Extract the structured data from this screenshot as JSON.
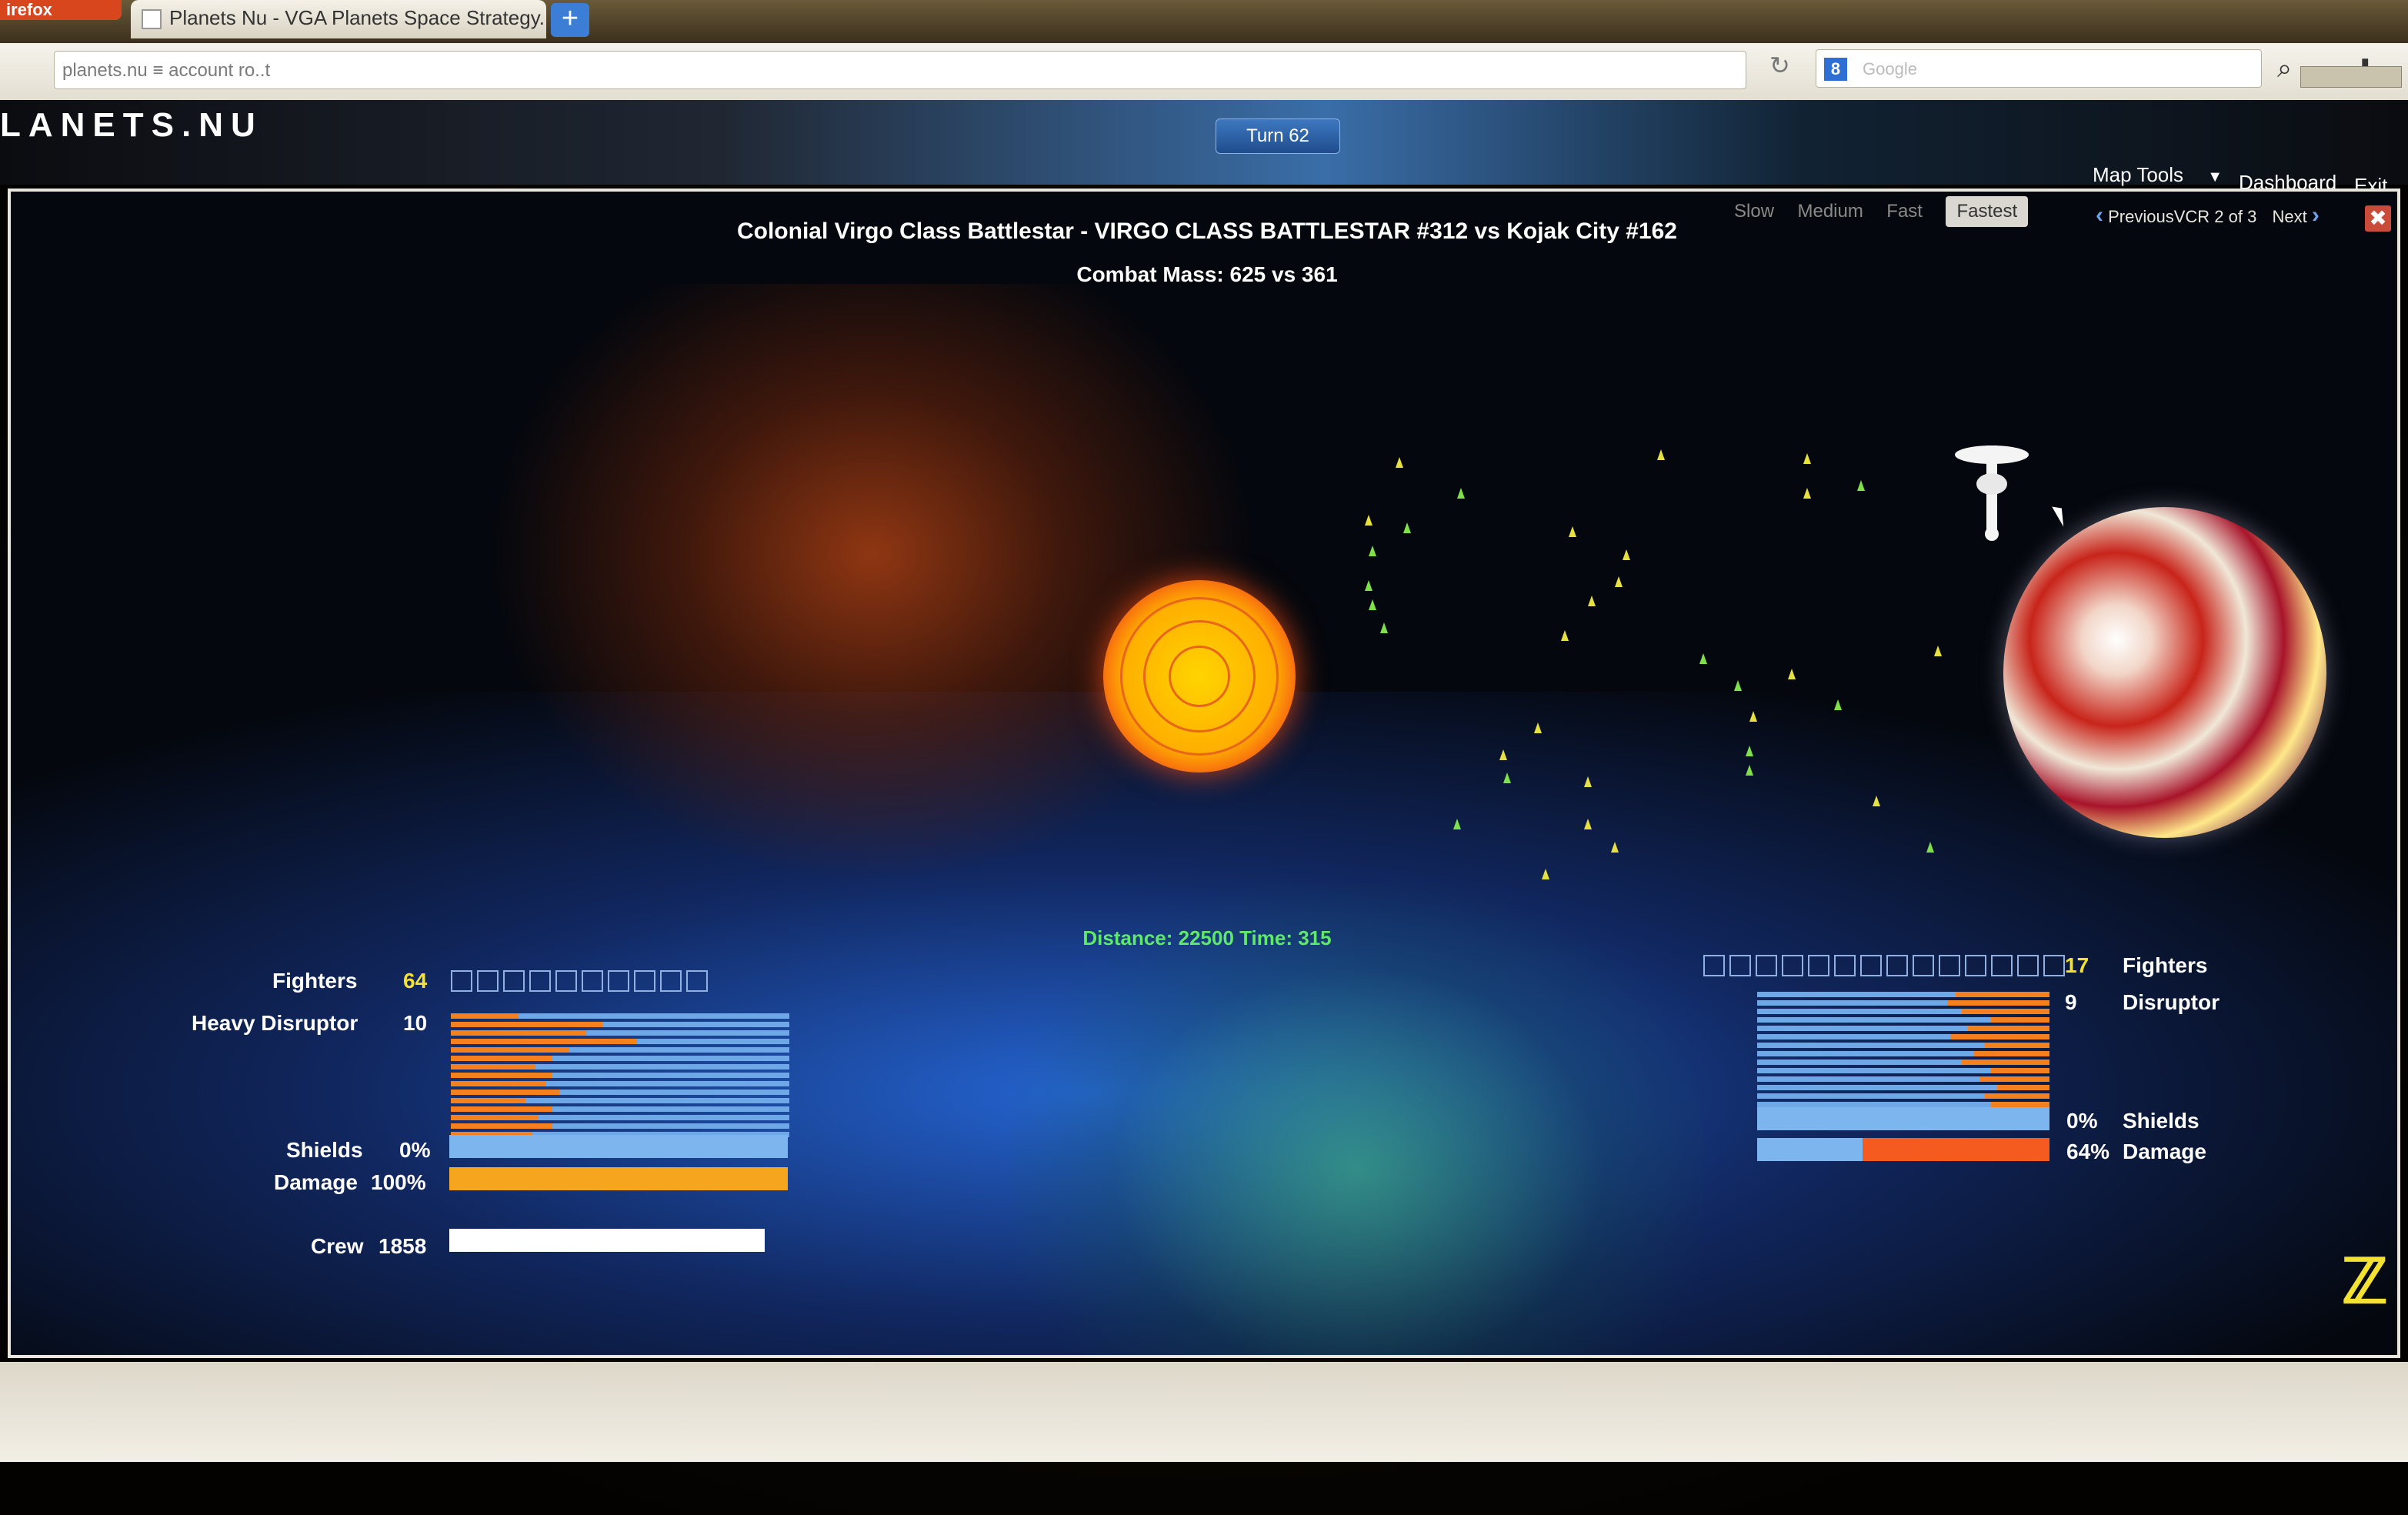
{
  "browser": {
    "menu_label": "irefox",
    "tab_title": "Planets Nu - VGA Planets Space Strategy...",
    "new_tab": "+",
    "url": "planets.nu ≡ account ro..t",
    "search_placeholder": "Google",
    "search_engine": "8"
  },
  "header": {
    "logo": "LANETS.NU",
    "turn": "Turn 62",
    "map_tools": "Map Tools",
    "map_tools_arrow": "▼",
    "dashboard": "Dashboard",
    "exit": "Exit"
  },
  "vcr": {
    "speeds": [
      "Slow",
      "Medium",
      "Fast",
      "Fastest"
    ],
    "active_speed": "Fastest",
    "prev": "Previous",
    "counter": "VCR 2 of 3",
    "next": "Next",
    "close": "✖",
    "title": "Colonial Virgo Class Battlestar - VIRGO CLASS BATTLESTAR #312 vs Kojak City #162",
    "combat_mass": "Combat Mass: 625 vs 361",
    "distance": "Distance: 22500  Time: 315"
  },
  "left": {
    "fighters_label": "Fighters",
    "fighters": "64",
    "weapon_label": "Heavy Disruptor",
    "weapon_count": "10",
    "shields_label": "Shields",
    "shields": "0%",
    "damage_label": "Damage",
    "damage": "100%",
    "crew_label": "Crew",
    "crew": "1858",
    "shields_level": 0,
    "damage_level": 1.0
  },
  "right": {
    "fighters_label": "Fighters",
    "fighters": "17",
    "weapon_label": "Disruptor",
    "weapon_count": "9",
    "shields_label": "Shields",
    "shields": "0%",
    "damage_label": "Damage",
    "damage": "64%",
    "shields_level": 0,
    "damage_level": 0.64
  },
  "colors": {
    "fighter_yellow": "#e6e040",
    "fighter_green": "#7fe04a",
    "damage_orange": "#f5801e",
    "shield_blue": "#7db6ef",
    "distance_green": "#5fe86a"
  }
}
